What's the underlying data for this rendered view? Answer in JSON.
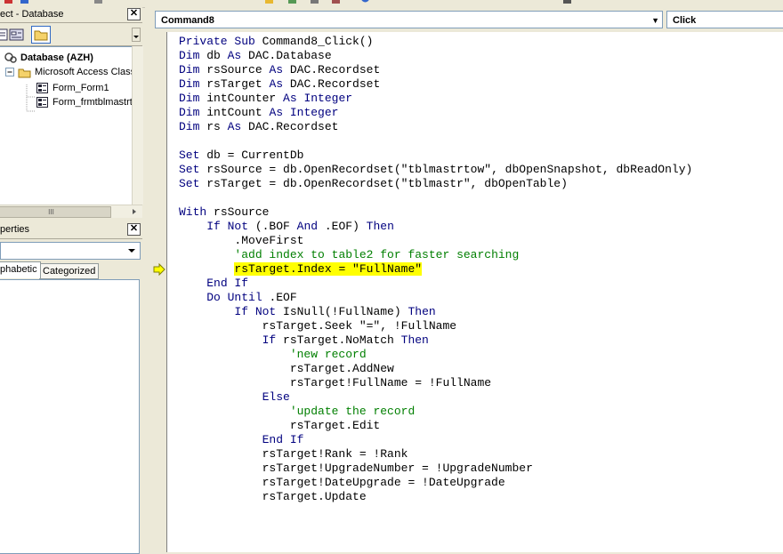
{
  "project_explorer": {
    "title": "ect - Database",
    "close_label": "✕",
    "tree": {
      "root": "Database (AZH)",
      "folder": "Microsoft Access Class O",
      "items": [
        "Form_Form1",
        "Form_frmtblmastrto"
      ]
    },
    "hscroll_thumb": "III"
  },
  "properties": {
    "title": "perties",
    "close_label": "✕",
    "tabs": [
      "phabetic",
      "Categorized"
    ]
  },
  "code_window": {
    "object_combo": "Command8",
    "procedure_combo": "Click",
    "lines": [
      [
        [
          "kw",
          "Private Sub "
        ],
        [
          "t",
          "Command8_Click()"
        ]
      ],
      [
        [
          "kw",
          "Dim "
        ],
        [
          "t",
          "db "
        ],
        [
          "kw",
          "As "
        ],
        [
          "t",
          "DAC.Database"
        ]
      ],
      [
        [
          "kw",
          "Dim "
        ],
        [
          "t",
          "rsSource "
        ],
        [
          "kw",
          "As "
        ],
        [
          "t",
          "DAC.Recordset"
        ]
      ],
      [
        [
          "kw",
          "Dim "
        ],
        [
          "t",
          "rsTarget "
        ],
        [
          "kw",
          "As "
        ],
        [
          "t",
          "DAC.Recordset"
        ]
      ],
      [
        [
          "kw",
          "Dim "
        ],
        [
          "t",
          "intCounter "
        ],
        [
          "kw",
          "As Integer"
        ]
      ],
      [
        [
          "kw",
          "Dim "
        ],
        [
          "t",
          "intCount "
        ],
        [
          "kw",
          "As Integer"
        ]
      ],
      [
        [
          "kw",
          "Dim "
        ],
        [
          "t",
          "rs "
        ],
        [
          "kw",
          "As "
        ],
        [
          "t",
          "DAC.Recordset"
        ]
      ],
      [],
      [
        [
          "kw",
          "Set "
        ],
        [
          "t",
          "db = CurrentDb"
        ]
      ],
      [
        [
          "kw",
          "Set "
        ],
        [
          "t",
          "rsSource = db.OpenRecordset(\"tblmastrtow\", dbOpenSnapshot, dbReadOnly)"
        ]
      ],
      [
        [
          "kw",
          "Set "
        ],
        [
          "t",
          "rsTarget = db.OpenRecordset(\"tblmastr\", dbOpenTable)"
        ]
      ],
      [],
      [
        [
          "kw",
          "With "
        ],
        [
          "t",
          "rsSource"
        ]
      ],
      [
        [
          "t",
          "    "
        ],
        [
          "kw",
          "If Not "
        ],
        [
          "t",
          "(.BOF "
        ],
        [
          "kw",
          "And "
        ],
        [
          "t",
          ".EOF) "
        ],
        [
          "kw",
          "Then"
        ]
      ],
      [
        [
          "t",
          "        .MoveFirst"
        ]
      ],
      [
        [
          "t",
          "        "
        ],
        [
          "cm",
          "'add index to table2 for faster searching"
        ]
      ],
      [
        [
          "t",
          "        "
        ],
        [
          "hl",
          "rsTarget.Index = \"FullName\""
        ]
      ],
      [
        [
          "t",
          "    "
        ],
        [
          "kw",
          "End If"
        ]
      ],
      [
        [
          "t",
          "    "
        ],
        [
          "kw",
          "Do Until "
        ],
        [
          "t",
          ".EOF"
        ]
      ],
      [
        [
          "t",
          "        "
        ],
        [
          "kw",
          "If Not "
        ],
        [
          "t",
          "IsNull(!FullName) "
        ],
        [
          "kw",
          "Then"
        ]
      ],
      [
        [
          "t",
          "            rsTarget.Seek \"=\", !FullName"
        ]
      ],
      [
        [
          "t",
          "            "
        ],
        [
          "kw",
          "If "
        ],
        [
          "t",
          "rsTarget.NoMatch "
        ],
        [
          "kw",
          "Then"
        ]
      ],
      [
        [
          "t",
          "                "
        ],
        [
          "cm",
          "'new record"
        ]
      ],
      [
        [
          "t",
          "                rsTarget.AddNew"
        ]
      ],
      [
        [
          "t",
          "                rsTarget!FullName = !FullName"
        ]
      ],
      [
        [
          "t",
          "            "
        ],
        [
          "kw",
          "Else"
        ]
      ],
      [
        [
          "t",
          "                "
        ],
        [
          "cm",
          "'update the record"
        ]
      ],
      [
        [
          "t",
          "                rsTarget.Edit"
        ]
      ],
      [
        [
          "t",
          "            "
        ],
        [
          "kw",
          "End If"
        ]
      ],
      [
        [
          "t",
          "            rsTarget!Rank = !Rank"
        ]
      ],
      [
        [
          "t",
          "            rsTarget!UpgradeNumber = !UpgradeNumber"
        ]
      ],
      [
        [
          "t",
          "            rsTarget!DateUpgrade = !DateUpgrade"
        ]
      ],
      [
        [
          "t",
          "            rsTarget.Update"
        ]
      ]
    ]
  },
  "colors": {
    "keyword": "#00007f",
    "comment": "#007f00",
    "highlight": "#ffff00",
    "marker": "#ffff00"
  },
  "icons": {
    "execution_marker": "arrow-right-icon",
    "view_code": "view-code-icon",
    "view_object": "view-object-icon",
    "toggle_folders": "folder-icon"
  }
}
